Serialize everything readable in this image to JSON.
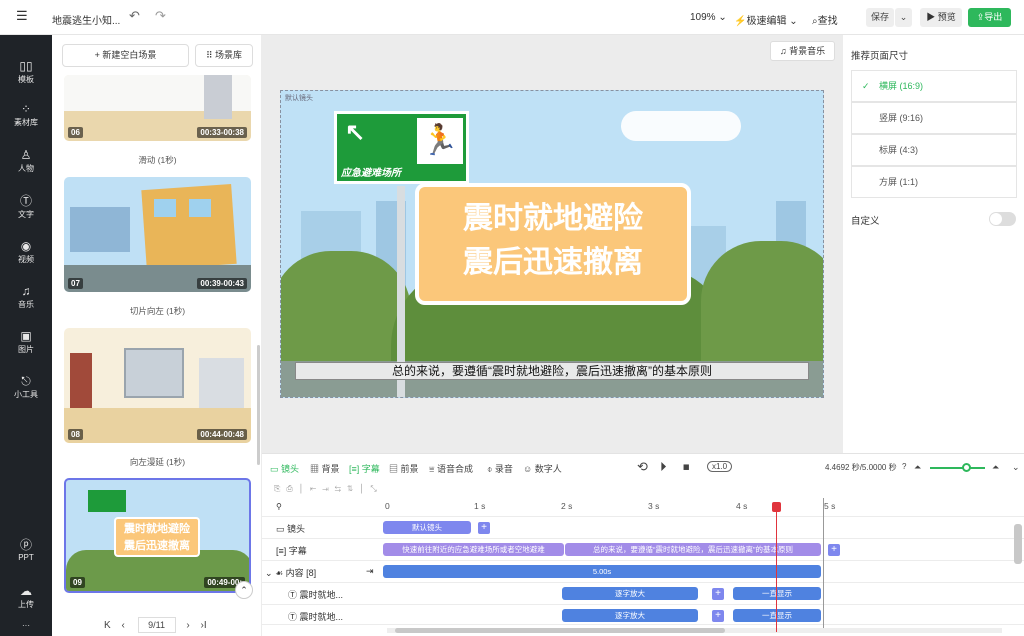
{
  "topbar": {
    "menu_icon": "menu-icon",
    "project_title": "地震逃生小知...",
    "zoom": "109%",
    "speed_edit": "极速编辑",
    "find": "查找",
    "save": "保存",
    "preview": "预览",
    "export": "导出"
  },
  "rail": {
    "items": [
      {
        "label": "模板",
        "icon": "template-icon"
      },
      {
        "label": "素材库",
        "icon": "material-icon"
      },
      {
        "label": "人物",
        "icon": "person-icon"
      },
      {
        "label": "文字",
        "icon": "text-icon"
      },
      {
        "label": "视频",
        "icon": "video-icon"
      },
      {
        "label": "音乐",
        "icon": "music-icon"
      },
      {
        "label": "图片",
        "icon": "image-icon"
      },
      {
        "label": "小工具",
        "icon": "tools-icon"
      },
      {
        "label": "PPT",
        "icon": "ppt-icon"
      },
      {
        "label": "上传",
        "icon": "upload-icon"
      }
    ]
  },
  "library": {
    "new_scene": "新建空白场景",
    "scene_lib": "场景库",
    "scenes": [
      {
        "num": "06",
        "time": "00:33-00:38",
        "caption": "滑动 (1秒)"
      },
      {
        "num": "07",
        "time": "00:39-00:43",
        "caption": "切片向左 (1秒)"
      },
      {
        "num": "08",
        "time": "00:44-00:48",
        "caption": "向左漫延 (1秒)"
      },
      {
        "num": "09",
        "time": "00:49-00:",
        "caption": ""
      }
    ],
    "page": "9/11",
    "thumb_text_1": "震时就地避险",
    "thumb_text_2": "震后迅速撤离"
  },
  "stage": {
    "bg_music": "背景音乐",
    "default_shot": "默认镜头",
    "sign_text": "应急避难场所",
    "headline_1": "震时就地避险",
    "headline_2": "震后迅速撤离",
    "subtitle": "总的来说，要遵循“震时就地避险，震后迅速撤离”的基本原则"
  },
  "right": {
    "title": "推荐页面尺寸",
    "options": [
      "横屏 (16:9)",
      "竖屏 (9:16)",
      "标屏 (4:3)",
      "方屏 (1:1)"
    ],
    "selected": 0,
    "custom": "自定义"
  },
  "timeline": {
    "tabs": [
      "镜头",
      "背景",
      "字幕",
      "前景",
      "语音合成",
      "录音",
      "数字人"
    ],
    "speed": "x1.0",
    "time": "4.4692 秒/5.0000 秒",
    "ticks": [
      "0",
      "1 s",
      "2 s",
      "3 s",
      "4 s",
      "5 s"
    ],
    "playhead_s": 4.4692,
    "duration_s": 5.0,
    "rows": {
      "shot_label": "镜头",
      "shot_clip": "默认镜头",
      "caption_label": "字幕",
      "caption_clip_1": "快速前往附近的应急避难场所或者空地避难",
      "caption_clip_2": "总的来说，要遵循“震时就地避险，震后迅速撤离”的基本原则",
      "content_label": "内容 [8]",
      "content_clip": "5.00s",
      "item1_label": "震时就地...",
      "item1_a": "逐字放大",
      "item1_b": "一直显示",
      "item2_label": "震时就地...",
      "item2_a": "逐字放大",
      "item2_b": "一直显示"
    }
  },
  "colors": {
    "accent": "#6c76e8",
    "green": "#2eb85c",
    "dark": "#1f2328"
  }
}
